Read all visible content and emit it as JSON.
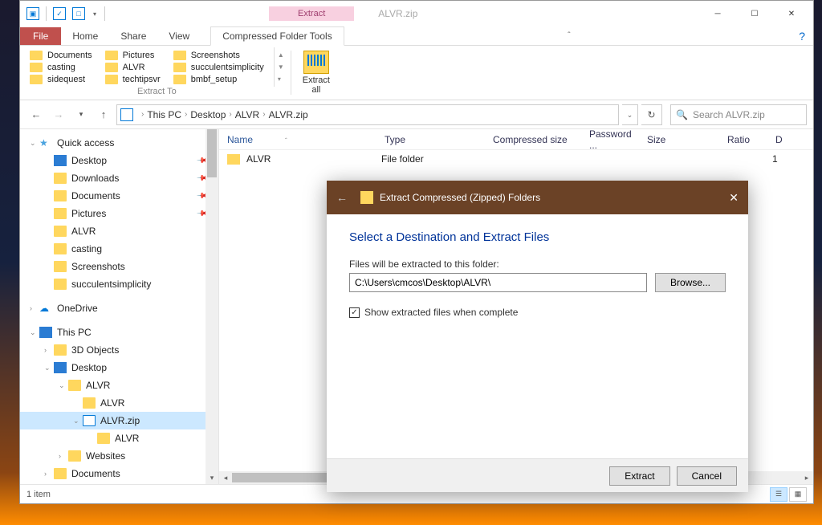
{
  "window": {
    "context_tab": "Extract",
    "title": "ALVR.zip",
    "tabs": {
      "file": "File",
      "home": "Home",
      "share": "Share",
      "view": "View",
      "compressed": "Compressed Folder Tools"
    }
  },
  "ribbon": {
    "col1": [
      "Documents",
      "casting",
      "sidequest"
    ],
    "col2": [
      "Pictures",
      "ALVR",
      "techtipsvr"
    ],
    "col3": [
      "Screenshots",
      "succulentsimplicity",
      "bmbf_setup"
    ],
    "group_label": "Extract To",
    "extract_all": "Extract\nall"
  },
  "breadcrumb": [
    "This PC",
    "Desktop",
    "ALVR",
    "ALVR.zip"
  ],
  "search_placeholder": "Search ALVR.zip",
  "columns": {
    "name": "Name",
    "type": "Type",
    "compressed": "Compressed size",
    "password": "Password ...",
    "size": "Size",
    "ratio": "Ratio",
    "date": "D"
  },
  "files": [
    {
      "name": "ALVR",
      "type": "File folder",
      "ratio_extra": "1"
    }
  ],
  "tree": {
    "quick_access": "Quick access",
    "qa_items": [
      "Desktop",
      "Downloads",
      "Documents",
      "Pictures",
      "ALVR",
      "casting",
      "Screenshots",
      "succulentsimplicity"
    ],
    "onedrive": "OneDrive",
    "this_pc": "This PC",
    "pc_items": [
      "3D Objects",
      "Desktop"
    ],
    "desktop_items": [
      "ALVR"
    ],
    "alvr_items": [
      "ALVR",
      "ALVR.zip"
    ],
    "zip_items": [
      "ALVR"
    ],
    "websites": "Websites",
    "documents": "Documents"
  },
  "status": {
    "items": "1 item"
  },
  "dialog": {
    "title": "Extract Compressed (Zipped) Folders",
    "heading": "Select a Destination and Extract Files",
    "label": "Files will be extracted to this folder:",
    "path": "C:\\Users\\cmcos\\Desktop\\ALVR\\",
    "browse": "Browse...",
    "checkbox": "Show extracted files when complete",
    "extract": "Extract",
    "cancel": "Cancel"
  }
}
